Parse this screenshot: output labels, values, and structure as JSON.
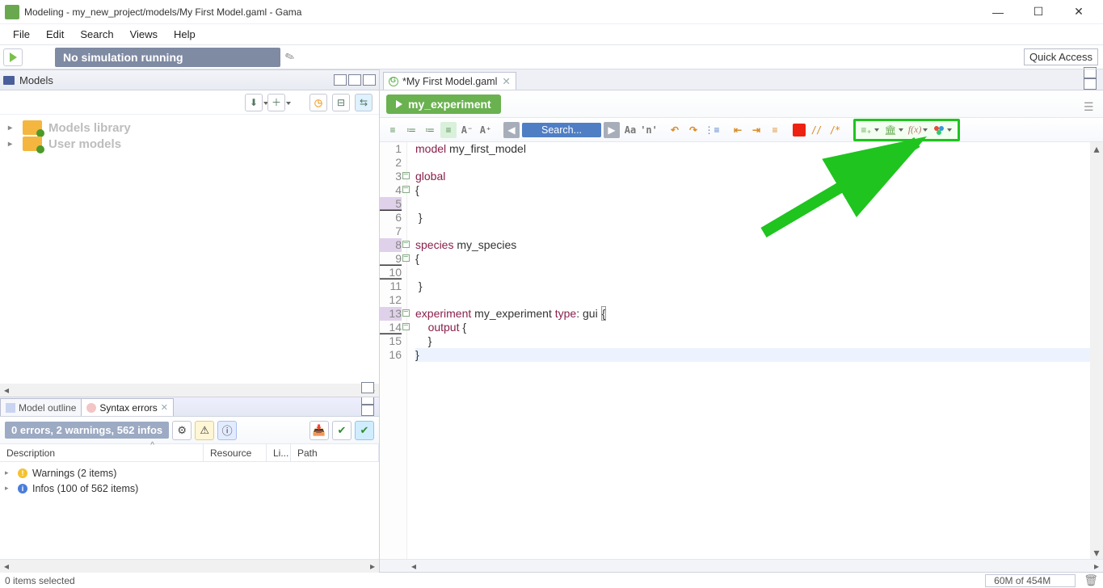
{
  "window": {
    "title": "Modeling - my_new_project/models/My First Model.gaml - Gama"
  },
  "menu": [
    "File",
    "Edit",
    "Search",
    "Views",
    "Help"
  ],
  "simulation_status": "No simulation running",
  "quick_access": "Quick Access",
  "models_panel": {
    "title": "Models",
    "tree": [
      {
        "label": "Models library"
      },
      {
        "label": "User models"
      }
    ]
  },
  "bottom_tabs": {
    "outline": "Model outline",
    "errors": "Syntax errors"
  },
  "errors_panel": {
    "status": "0 errors, 2 warnings, 562 infos",
    "columns": {
      "desc": "Description",
      "res": "Resource",
      "li": "Li...",
      "path": "Path"
    },
    "rows": [
      {
        "kind": "w",
        "label": "Warnings (2 items)"
      },
      {
        "kind": "i",
        "label": "Infos (100 of 562 items)"
      }
    ]
  },
  "editor": {
    "tab": "*My First Model.gaml",
    "experiment_button": "my_experiment",
    "search_placeholder": "Search...",
    "lines": [
      {
        "n": 1,
        "tokens": [
          [
            "kw",
            "model"
          ],
          [
            "ws",
            " "
          ],
          [
            "name",
            "my_first_model"
          ]
        ]
      },
      {
        "n": 2,
        "tokens": []
      },
      {
        "n": 3,
        "fold": true,
        "tokens": [
          [
            "kw",
            "global"
          ]
        ]
      },
      {
        "n": 4,
        "fold": true,
        "tokens": [
          [
            "punct",
            "{"
          ]
        ]
      },
      {
        "n": 5,
        "hi": true,
        "ul": true,
        "tokens": []
      },
      {
        "n": 6,
        "tokens": [
          [
            "punct",
            " }"
          ]
        ]
      },
      {
        "n": 7,
        "tokens": []
      },
      {
        "n": 8,
        "hi": true,
        "fold": true,
        "tokens": [
          [
            "kw",
            "species"
          ],
          [
            "ws",
            " "
          ],
          [
            "name",
            "my_species"
          ]
        ]
      },
      {
        "n": 9,
        "fold": true,
        "ul": true,
        "tokens": [
          [
            "punct",
            "{"
          ]
        ]
      },
      {
        "n": 10,
        "ul": true,
        "tokens": []
      },
      {
        "n": 11,
        "tokens": [
          [
            "punct",
            " }"
          ]
        ]
      },
      {
        "n": 12,
        "tokens": []
      },
      {
        "n": 13,
        "hi": true,
        "fold": true,
        "tokens": [
          [
            "kw",
            "experiment"
          ],
          [
            "ws",
            " "
          ],
          [
            "name",
            "my_experiment"
          ],
          [
            "ws",
            " "
          ],
          [
            "kw",
            "type"
          ],
          [
            "punct",
            ": "
          ],
          [
            "name",
            "gui"
          ],
          [
            "ws",
            " "
          ],
          [
            "box",
            "{"
          ]
        ]
      },
      {
        "n": 14,
        "fold": true,
        "ul": true,
        "tokens": [
          [
            "ws",
            "    "
          ],
          [
            "kw",
            "output"
          ],
          [
            "ws",
            " "
          ],
          [
            "punct",
            "{"
          ]
        ]
      },
      {
        "n": 15,
        "tokens": [
          [
            "ws",
            "    "
          ],
          [
            "punct",
            "}"
          ]
        ]
      },
      {
        "n": 16,
        "hl": true,
        "tokens": [
          [
            "punct",
            "}"
          ]
        ]
      }
    ]
  },
  "status_bar": {
    "left": "0 items selected",
    "memory": "60M of 454M"
  }
}
